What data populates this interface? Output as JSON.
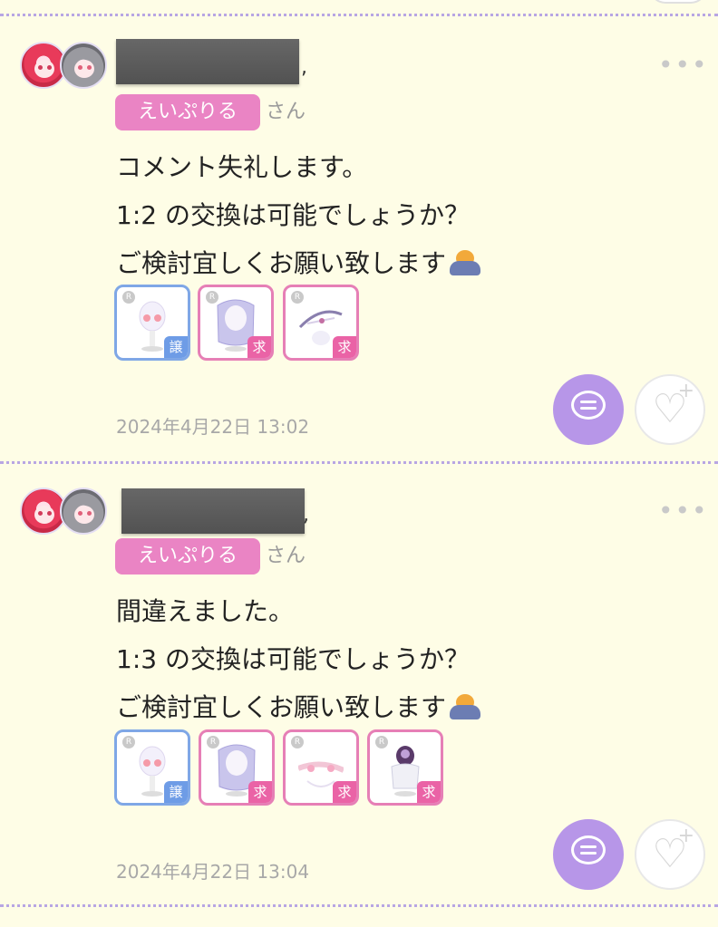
{
  "comments": [
    {
      "tag": "えいぷりる",
      "honorific": "さん",
      "lines": [
        "コメント失礼します。",
        "1:2 の交換は可能でしょうか？",
        "ご検討宜しくお願い致します"
      ],
      "items": [
        {
          "type": "give",
          "badge": "譲",
          "rarity": "R"
        },
        {
          "type": "want",
          "badge": "求",
          "rarity": "R"
        },
        {
          "type": "want",
          "badge": "求",
          "rarity": "R"
        }
      ],
      "timestamp": "2024年4月22日 13:02",
      "more": "•••"
    },
    {
      "tag": "えいぷりる",
      "honorific": "さん",
      "lines": [
        "間違えました。",
        "1:3 の交換は可能でしょうか？",
        "ご検討宜しくお願い致します"
      ],
      "items": [
        {
          "type": "give",
          "badge": "譲",
          "rarity": "R"
        },
        {
          "type": "want",
          "badge": "求",
          "rarity": "R"
        },
        {
          "type": "want",
          "badge": "求",
          "rarity": "R"
        },
        {
          "type": "want",
          "badge": "求",
          "rarity": "R"
        }
      ],
      "timestamp": "2024年4月22日 13:04",
      "more": "•••"
    }
  ],
  "colors": {
    "background": "#fefde6",
    "tag": "#ea84c4",
    "reply_button": "#b796e8",
    "give_border": "#7fa7e6",
    "want_border": "#e67fb6",
    "divider": "#b8a6e3"
  },
  "icons": [
    "more-icon",
    "reply-bubble-icon",
    "heart-plus-icon",
    "bowing-person-icon"
  ]
}
